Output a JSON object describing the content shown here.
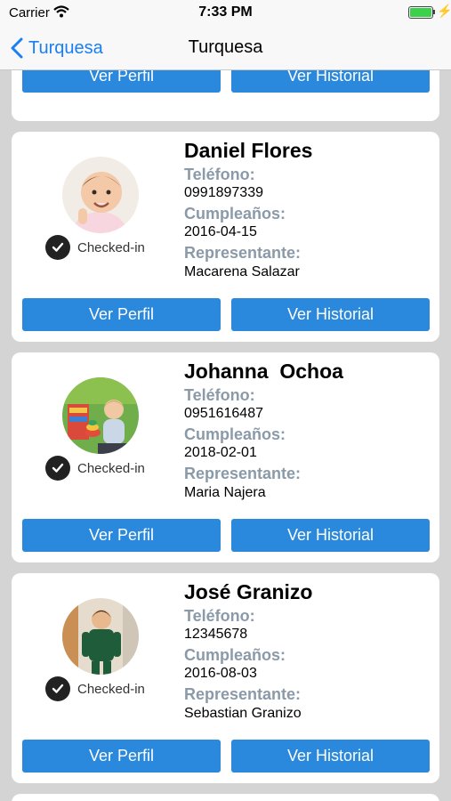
{
  "status_bar": {
    "carrier": "Carrier",
    "time": "7:33 PM"
  },
  "nav": {
    "back_label": "Turquesa",
    "title": "Turquesa"
  },
  "top_card": {
    "profile_button": "Ver Perfil",
    "history_button": "Ver Historial"
  },
  "cards": [
    {
      "name": "Daniel Flores",
      "checked_in": "Checked-in",
      "phone_label": "Teléfono:",
      "phone": "0991897339",
      "birthday_label": "Cumpleaños:",
      "birthday": "2016-04-15",
      "representative_label": "Representante:",
      "representative": "Macarena Salazar",
      "profile_button": "Ver Perfil",
      "history_button": "Ver Historial"
    },
    {
      "name": "Johanna  Ochoa",
      "checked_in": "Checked-in",
      "phone_label": "Teléfono:",
      "phone": "0951616487",
      "birthday_label": "Cumpleaños:",
      "birthday": "2018-02-01",
      "representative_label": "Representante:",
      "representative": "Maria Najera",
      "profile_button": "Ver Perfil",
      "history_button": "Ver Historial"
    },
    {
      "name": "José Granizo",
      "checked_in": "Checked-in",
      "phone_label": "Teléfono:",
      "phone": "12345678",
      "birthday_label": "Cumpleaños:",
      "birthday": "2016-08-03",
      "representative_label": "Representante:",
      "representative": "Sebastian Granizo",
      "profile_button": "Ver Perfil",
      "history_button": "Ver Historial"
    }
  ],
  "icons": {
    "back": "chevron-left-icon",
    "checked_in": "checkmark-icon",
    "wifi": "wifi-icon",
    "battery": "battery-icon"
  },
  "colors": {
    "accent": "#1a7ef5",
    "button": "#2a88dd",
    "label_gray": "#8a9aa8",
    "background": "#d4d4d4"
  }
}
